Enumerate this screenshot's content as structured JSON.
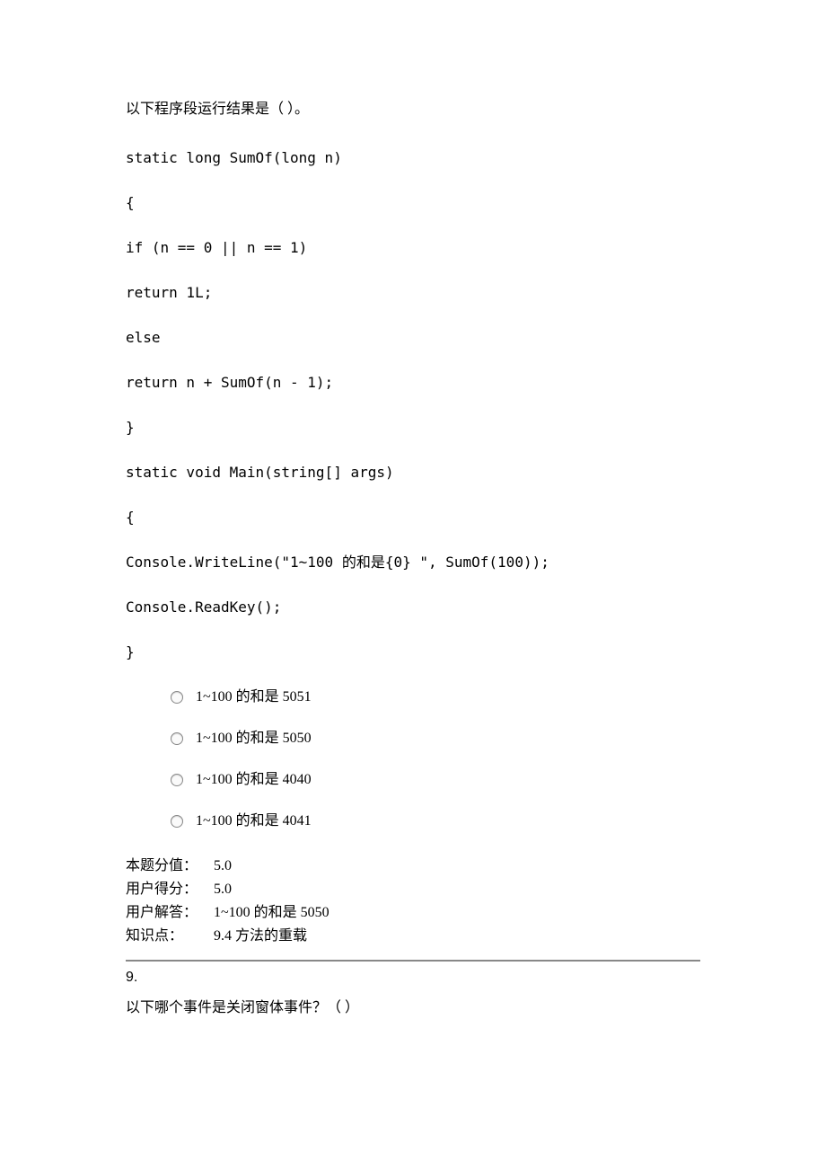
{
  "question": {
    "prompt": "以下程序段运行结果是（ ）。",
    "code": [
      "static long SumOf(long n)",
      "{",
      "if (n == 0 || n == 1)",
      "return 1L;",
      "else",
      "return n + SumOf(n - 1);",
      "}",
      "static void Main(string[] args)",
      "{",
      "Console.WriteLine(\"1~100 的和是{0} \", SumOf(100));",
      "Console.ReadKey();",
      "}"
    ],
    "options": [
      "1~100 的和是 5051",
      "1~100 的和是 5050",
      "1~100 的和是 4040",
      "1~100 的和是 4041"
    ],
    "meta": {
      "score_label": "本题分值：",
      "score_value": "5.0",
      "user_score_label": "用户得分：",
      "user_score_value": "5.0",
      "user_answer_label": "用户解答：",
      "user_answer_value": "1~100 的和是 5050",
      "knowledge_label": "知识点：",
      "knowledge_value": "9.4 方法的重载"
    }
  },
  "next": {
    "number": "9.",
    "prompt": "以下哪个事件是关闭窗体事件？（ ）"
  }
}
